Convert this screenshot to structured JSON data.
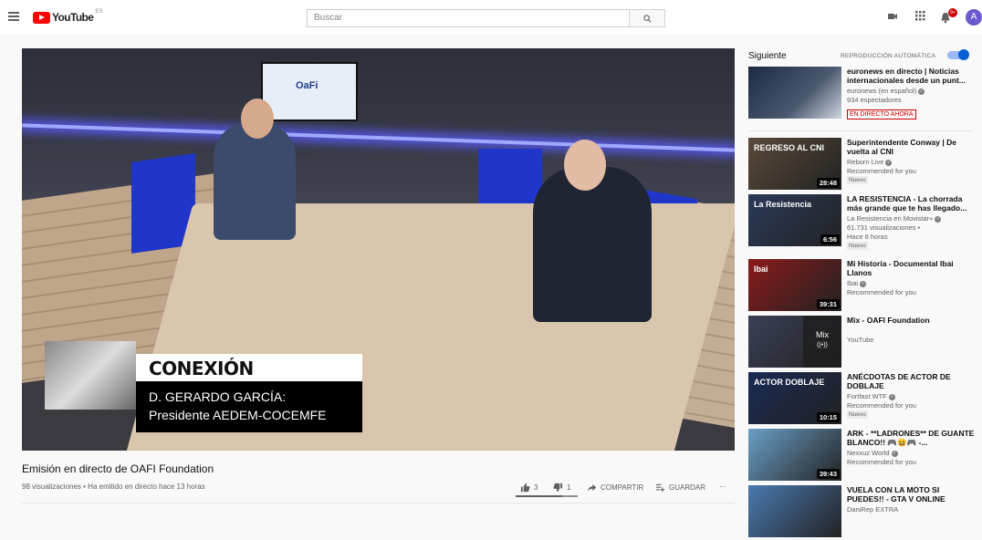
{
  "header": {
    "logo_text": "YouTube",
    "logo_region": "ES",
    "search_placeholder": "Buscar",
    "notifications_count": "9+",
    "avatar_letter": "A"
  },
  "player": {
    "screen_logo": "OaFi",
    "lower_third_title": "CONEXIÓN",
    "lower_third_line1": "D. GERARDO GARCÍA:",
    "lower_third_line2": "Presidente AEDEM-COCEMFE"
  },
  "video": {
    "title": "Emisión en directo de OAFI Foundation",
    "meta": "98 visualizaciones • Ha emitido en directo hace 13 horas",
    "likes": "3",
    "dislikes": "1",
    "like_ratio": 0.75,
    "share_label": "COMPARTIR",
    "save_label": "GUARDAR",
    "more_label": "···"
  },
  "sidebar": {
    "up_next": "Siguiente",
    "autoplay_label": "REPRODUCCIÓN AUTOMÁTICA",
    "autoplay_on": true,
    "first": {
      "title": "euronews en directo | Noticias internacionales desde un punt...",
      "channel": "euronews (en español)",
      "line2": "934 espectadores",
      "badge": "EN DIRECTO AHORA"
    },
    "items": [
      {
        "title": "Superintendente Conway | De vuelta al CNI",
        "channel": "Reborn Live",
        "line2": "Recommended for you",
        "badge": "Nuevo",
        "duration": "28:48",
        "thumb_text": "REGRESO AL CNI",
        "thumb_color": "#5a4a3a"
      },
      {
        "title": "LA RESISTENCIA - La chorrada más grande que te has llegado...",
        "channel": "La Resistencia en Movistar+",
        "line2": "61.731 visualizaciones •",
        "line3": "Hace 8 horas",
        "badge": "Nuevo",
        "duration": "6:56",
        "thumb_text": "La Resistencia",
        "thumb_color": "#2a3a5a"
      },
      {
        "title": "Mi Historia - Documental Ibai Llanos",
        "channel": "Ibai",
        "line2": "Recommended for you",
        "duration": "39:31",
        "thumb_text": "Ibai",
        "thumb_color": "#8a1a1a"
      },
      {
        "title": "Mix - OAFI Foundation",
        "channel": "YouTube",
        "mix_label": "Mix",
        "thumb_color": "#3a3f55"
      },
      {
        "title": "ANÉCDOTAS DE ACTOR DE DOBLAJE",
        "channel": "Fortfast WTF",
        "line2": "Recommended for you",
        "badge": "Nuevo",
        "duration": "10:15",
        "thumb_text": "ACTOR DOBLAJE",
        "thumb_color": "#1a2a55"
      },
      {
        "title": "ARK - **LADRONES** DE GUANTE BLANCO!! 🎮😆🎮 -...",
        "channel": "Nexxuz World",
        "line2": "Recommended for you",
        "duration": "39:43",
        "thumb_color": "#6aa0c8"
      },
      {
        "title": "VUELA CON LA MOTO SI PUEDES!! - GTA V ONLINE",
        "channel": "DaniRep EXTRA",
        "thumb_color": "#4a7ab0"
      }
    ]
  }
}
